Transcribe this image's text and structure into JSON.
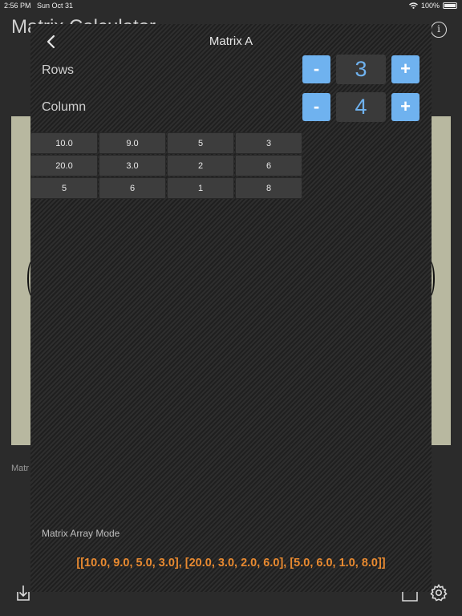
{
  "status_bar": {
    "time": "2:56 PM",
    "date": "Sun Oct 31",
    "battery": "100%"
  },
  "background_app": {
    "title": "Matrix Calculator",
    "side_label": "Matr"
  },
  "modal": {
    "title": "Matrix A",
    "rows": {
      "label": "Rows",
      "value": "3",
      "minus": "-",
      "plus": "+"
    },
    "columns": {
      "label": "Column",
      "value": "4",
      "minus": "-",
      "plus": "+"
    },
    "matrix": [
      [
        "10.0",
        "9.0",
        "5",
        "3"
      ],
      [
        "20.0",
        "3.0",
        "2",
        "6"
      ],
      [
        "5",
        "6",
        "1",
        "8"
      ]
    ],
    "array_mode_label": "Matrix Array Mode",
    "array_value": "[[10.0, 9.0, 5.0, 3.0], [20.0, 3.0, 2.0, 6.0], [5.0, 6.0, 1.0, 8.0]]"
  },
  "colors": {
    "accent_blue": "#6fb2ef",
    "array_orange": "#e98a30",
    "background_panel": "#b8b8a0"
  }
}
